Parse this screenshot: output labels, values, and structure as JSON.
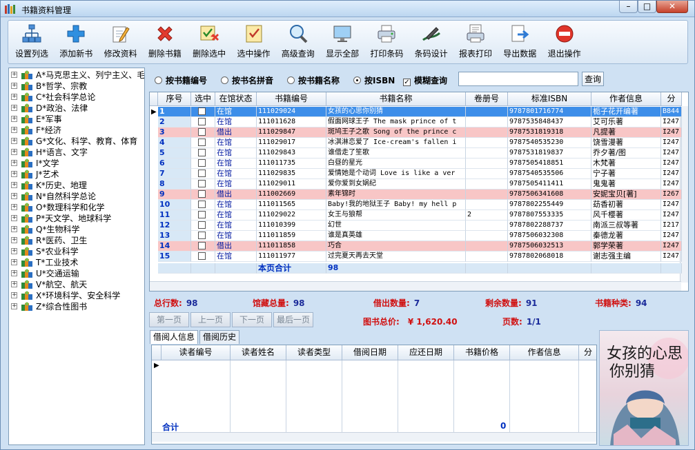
{
  "window": {
    "title": "书籍资料管理",
    "min": "–",
    "max": "□",
    "close": "✕"
  },
  "toolbar": [
    {
      "label": "设置列选",
      "icon": "column-settings-icon"
    },
    {
      "label": "添加新书",
      "icon": "plus-icon"
    },
    {
      "label": "修改资料",
      "icon": "pencil-icon"
    },
    {
      "label": "删除书籍",
      "icon": "delete-x-icon"
    },
    {
      "label": "删除选中",
      "icon": "delete-selected-icon"
    },
    {
      "label": "选中操作",
      "icon": "check-document-icon"
    },
    {
      "label": "高级查询",
      "icon": "magnifier-icon"
    },
    {
      "label": "显示全部",
      "icon": "monitor-icon"
    },
    {
      "label": "打印条码",
      "icon": "printer-icon"
    },
    {
      "label": "条码设计",
      "icon": "pen-design-icon"
    },
    {
      "label": "报表打印",
      "icon": "report-printer-icon"
    },
    {
      "label": "导出数据",
      "icon": "export-icon"
    },
    {
      "label": "退出操作",
      "icon": "exit-stop-icon"
    }
  ],
  "tree": [
    "A*马克思主义、列宁主义、毛",
    "B*哲学、宗教",
    "C*社会科学总论",
    "D*政治、法律",
    "E*军事",
    "F*经济",
    "G*文化、科学、教育、体育",
    "H*语言、文字",
    "I*文学",
    "J*艺术",
    "K*历史、地理",
    "N*自然科学总论",
    "O*数理科学和化学",
    "P*天文学、地球科学",
    "Q*生物科学",
    "R*医药、卫生",
    "S*农业科学",
    "T*工业技术",
    "U*交通运输",
    "V*航空、航天",
    "X*环境科学、安全科学",
    "Z*综合性图书"
  ],
  "tree_expander": "+",
  "filter": {
    "options": [
      "按书籍编号",
      "按书名拼音",
      "按书籍名称",
      "按ISBN"
    ],
    "selected_index": 3,
    "fuzzy_label": "模糊查询",
    "fuzzy_checked": true,
    "fuzzy_mark": "✓",
    "search_value": "",
    "search_button": "查询"
  },
  "grid": {
    "headers": [
      "序号",
      "选中",
      "在馆状态",
      "书籍编号",
      "书籍名称",
      "卷册号",
      "标准ISBN",
      "作者信息",
      "分"
    ],
    "indicator": "▶",
    "rows": [
      {
        "no": "1",
        "status": "在馆",
        "code": "111029024",
        "name": "女孩的心思你别猜",
        "vol": "",
        "isbn": "9787801716774",
        "author": "栀子花开编著",
        "cat": "B844",
        "hl": "selected"
      },
      {
        "no": "2",
        "status": "在馆",
        "code": "111011628",
        "name": "假面网球王子 The mask prince of t",
        "vol": "",
        "isbn": "9787535848437",
        "author": "艾可乐著",
        "cat": "I247",
        "hl": ""
      },
      {
        "no": "3",
        "status": "借出",
        "code": "111029847",
        "name": "斑鸠王子之歌 Song of the prince c",
        "vol": "",
        "isbn": "9787531819318",
        "author": "凡提著",
        "cat": "I247",
        "hl": "pink"
      },
      {
        "no": "4",
        "status": "在馆",
        "code": "111029017",
        "name": "冰淇淋恋爱了 Ice-cream's fallen i",
        "vol": "",
        "isbn": "9787540535230",
        "author": "饶雪漫著",
        "cat": "I247",
        "hl": ""
      },
      {
        "no": "5",
        "status": "在馆",
        "code": "111029843",
        "name": "谁借走了笙歌",
        "vol": "",
        "isbn": "9787531819837",
        "author": "乔夕著/图",
        "cat": "I247",
        "hl": ""
      },
      {
        "no": "6",
        "status": "在馆",
        "code": "111011735",
        "name": "白昼的星光",
        "vol": "",
        "isbn": "9787505418851",
        "author": "木梵著",
        "cat": "I247",
        "hl": ""
      },
      {
        "no": "7",
        "status": "在馆",
        "code": "111029835",
        "name": "爱情她是个动词 Love is like a ver",
        "vol": "",
        "isbn": "9787540535506",
        "author": "宁子著",
        "cat": "I247",
        "hl": ""
      },
      {
        "no": "8",
        "status": "在馆",
        "code": "111029011",
        "name": "爱你爱到女娲纪",
        "vol": "",
        "isbn": "9787505411411",
        "author": "鬼鬼著",
        "cat": "I247",
        "hl": ""
      },
      {
        "no": "9",
        "status": "借出",
        "code": "111002669",
        "name": "素年锦时",
        "vol": "",
        "isbn": "9787506341608",
        "author": "安妮宝贝[著]",
        "cat": "I267",
        "hl": "pink"
      },
      {
        "no": "10",
        "status": "在馆",
        "code": "111011565",
        "name": "Baby!我的地狱王子 Baby! my hell p",
        "vol": "",
        "isbn": "9787802255449",
        "author": "苭香初著",
        "cat": "I247",
        "hl": ""
      },
      {
        "no": "11",
        "status": "在馆",
        "code": "111029022",
        "name": "女王与狼帮",
        "vol": "2",
        "isbn": "9787807553335",
        "author": "风千樱著",
        "cat": "I247",
        "hl": ""
      },
      {
        "no": "12",
        "status": "在馆",
        "code": "111010399",
        "name": "幻世",
        "vol": "",
        "isbn": "9787802288737",
        "author": "南派三叔等著",
        "cat": "I217",
        "hl": ""
      },
      {
        "no": "13",
        "status": "在馆",
        "code": "111011859",
        "name": "谁是真英雄",
        "vol": "",
        "isbn": "9787506032308",
        "author": "秦德龙著",
        "cat": "I247",
        "hl": ""
      },
      {
        "no": "14",
        "status": "借出",
        "code": "111011858",
        "name": "巧合",
        "vol": "",
        "isbn": "9787506032513",
        "author": "郭学荣著",
        "cat": "I247",
        "hl": "pink"
      },
      {
        "no": "15",
        "status": "在馆",
        "code": "111011977",
        "name": "过完夏天再去天堂",
        "vol": "",
        "isbn": "9787802068018",
        "author": "谢志强主编",
        "cat": "I247",
        "hl": ""
      }
    ],
    "footer_label": "本页合计",
    "footer_value": "98"
  },
  "stats": [
    {
      "label": "总行数:",
      "value": "98"
    },
    {
      "label": "馆藏总量:",
      "value": "98"
    },
    {
      "label": "借出数量:",
      "value": "7"
    },
    {
      "label": "剩余数量:",
      "value": "91"
    },
    {
      "label": "书籍种类:",
      "value": "94"
    }
  ],
  "pager": {
    "first": "第一页",
    "prev": "上一页",
    "next": "下一页",
    "last": "最后一页",
    "total_price_label": "图书总价:",
    "total_price": "¥ 1,620.40",
    "pages_label": "页数:",
    "pages": "1/1"
  },
  "tabs": [
    "借阅人信息",
    "借阅历史"
  ],
  "borrow": {
    "headers": [
      "读者编号",
      "读者姓名",
      "读者类型",
      "借阅日期",
      "应还日期",
      "书籍价格",
      "作者信息",
      "分"
    ],
    "footer_label": "合计",
    "footer_value": "0",
    "indicator": "▶"
  },
  "cover": {
    "title_line1": "女孩的心思",
    "title_line2": "你别猜"
  },
  "colors": {
    "accent_blue": "#3d8ee9",
    "lent_pink": "#f8c6c6",
    "stat_red": "#d01010",
    "stat_blue": "#1a2a9a"
  }
}
